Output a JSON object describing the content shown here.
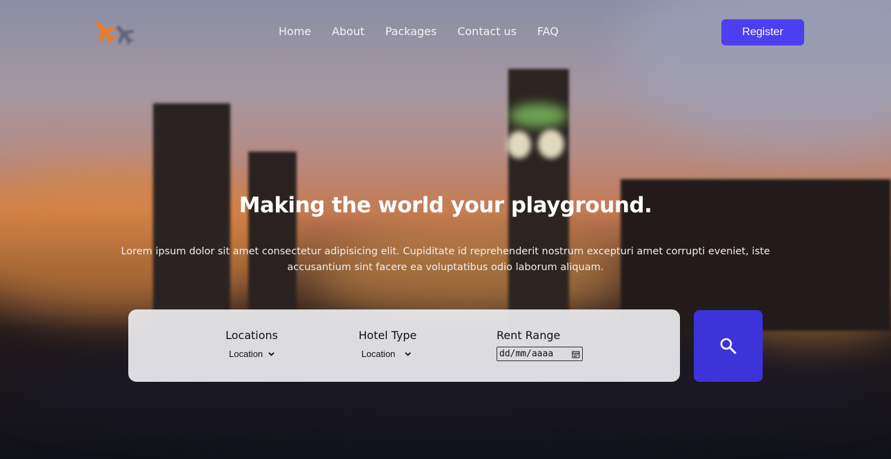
{
  "nav": {
    "links": [
      "Home",
      "About",
      "Packages",
      "Contact us",
      "FAQ"
    ],
    "register_label": "Register",
    "logo_icon": "airplane-icon"
  },
  "hero": {
    "title": "Making the world your playground.",
    "description": "Lorem ipsum dolor sit amet consectetur adipisicing elit. Cupiditate id reprehenderit nostrum excepturi amet corrupti eveniet, iste accusantium sint facere ea voluptatibus odio laborum aliquam."
  },
  "search": {
    "locations": {
      "label": "Locations",
      "selected": "Location"
    },
    "hotel_type": {
      "label": "Hotel Type",
      "selected": "Location"
    },
    "rent_range": {
      "label": "Rent Range",
      "date_value": "dd/mm/aaaa"
    },
    "search_icon": "search-icon"
  },
  "colors": {
    "accent": "#4b3ff0",
    "search_button": "#3c33d8",
    "logo_plane": "#f07a1e"
  }
}
